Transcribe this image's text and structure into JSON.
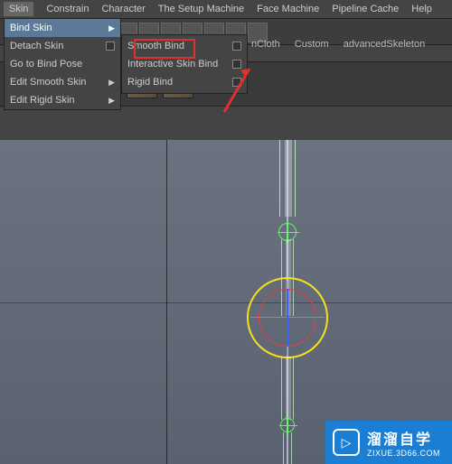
{
  "menubar": [
    "Skin",
    "Constrain",
    "Character",
    "The Setup Machine",
    "Face Machine",
    "Pipeline Cache",
    "Help"
  ],
  "skin_menu": {
    "items": [
      {
        "label": "Bind Skin",
        "has_sub": true,
        "active": true
      },
      {
        "label": "Detach Skin",
        "has_box": true
      },
      {
        "label": "Go to Bind Pose"
      },
      {
        "label": "Edit Smooth Skin",
        "has_sub": true
      },
      {
        "label": "Edit Rigid Skin",
        "has_sub": true
      }
    ]
  },
  "bind_submenu": {
    "items": [
      {
        "label": "Smooth Bind"
      },
      {
        "label": "Interactive Skin Bind"
      },
      {
        "label": "Rigid Bind"
      }
    ]
  },
  "shelf_tabs": [
    "nCloth",
    "Custom",
    "advancedSkeleton"
  ],
  "watermark": {
    "title": "溜溜自学",
    "sub": "ZIXUE.3D66.COM"
  }
}
